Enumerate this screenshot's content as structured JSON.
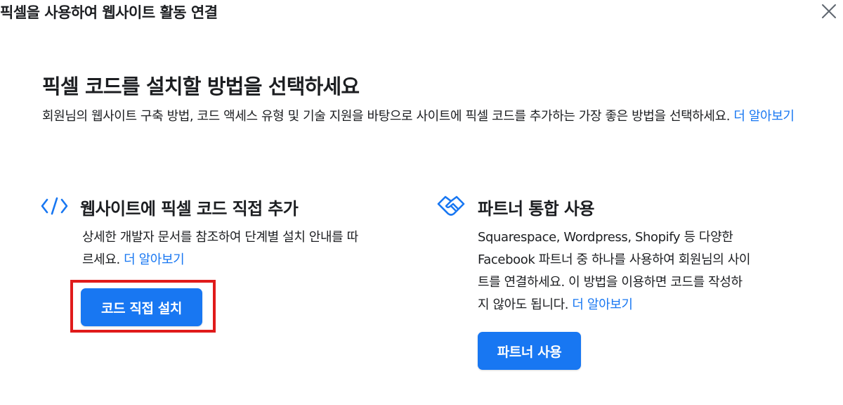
{
  "dialog": {
    "title": "픽셀을 사용하여 웹사이트 활동 연결",
    "close_icon": "close-icon"
  },
  "main": {
    "heading": "픽셀 코드를 설치할 방법을 선택하세요",
    "intro_text": "회원님의 웹사이트 구축 방법, 코드 액세스 유형 및 기술 지원을 바탕으로 사이트에 픽셀 코드를 추가하는 가장 좋은 방법을 선택하세요.",
    "learn_more": "더 알아보기"
  },
  "options": [
    {
      "icon": "code-icon",
      "title": "웹사이트에 픽셀 코드 직접 추가",
      "description": "상세한 개발자 문서를 참조하여 단계별 설치 안내를 따르세요.",
      "learn_more": "더 알아보기",
      "button_label": "코드 직접 설치"
    },
    {
      "icon": "handshake-icon",
      "title": "파트너 통합 사용",
      "description": "Squarespace, Wordpress, Shopify 등 다양한 Facebook 파트너 중 하나를 사용하여 회원님의 사이트를 연결하세요. 이 방법을 이용하면 코드를 작성하지 않아도 됩니다.",
      "learn_more": "더 알아보기",
      "button_label": "파트너 사용"
    }
  ],
  "colors": {
    "accent": "#1877f2",
    "highlight_border": "#e01b1b",
    "text": "#1c1e21"
  }
}
